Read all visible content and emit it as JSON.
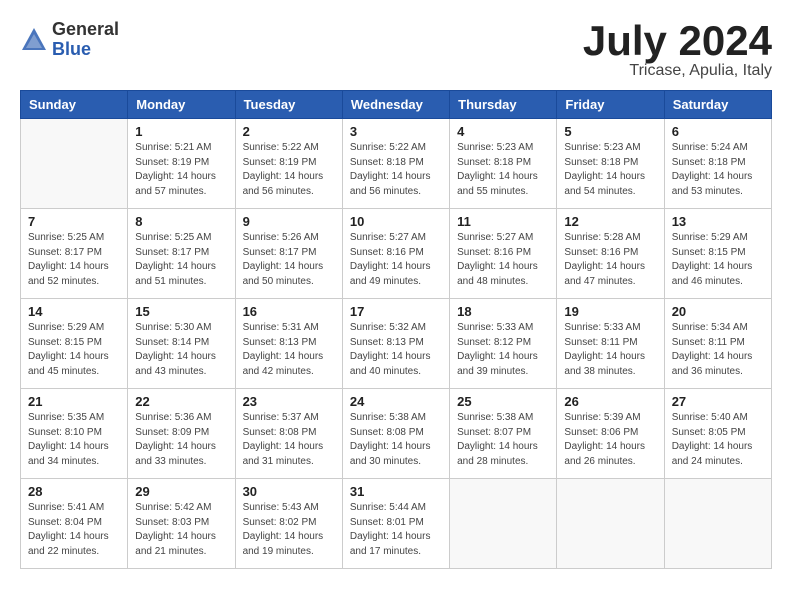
{
  "logo": {
    "general": "General",
    "blue": "Blue"
  },
  "title": {
    "month_year": "July 2024",
    "location": "Tricase, Apulia, Italy"
  },
  "days_of_week": [
    "Sunday",
    "Monday",
    "Tuesday",
    "Wednesday",
    "Thursday",
    "Friday",
    "Saturday"
  ],
  "weeks": [
    [
      {
        "day": "",
        "info": ""
      },
      {
        "day": "1",
        "info": "Sunrise: 5:21 AM\nSunset: 8:19 PM\nDaylight: 14 hours\nand 57 minutes."
      },
      {
        "day": "2",
        "info": "Sunrise: 5:22 AM\nSunset: 8:19 PM\nDaylight: 14 hours\nand 56 minutes."
      },
      {
        "day": "3",
        "info": "Sunrise: 5:22 AM\nSunset: 8:18 PM\nDaylight: 14 hours\nand 56 minutes."
      },
      {
        "day": "4",
        "info": "Sunrise: 5:23 AM\nSunset: 8:18 PM\nDaylight: 14 hours\nand 55 minutes."
      },
      {
        "day": "5",
        "info": "Sunrise: 5:23 AM\nSunset: 8:18 PM\nDaylight: 14 hours\nand 54 minutes."
      },
      {
        "day": "6",
        "info": "Sunrise: 5:24 AM\nSunset: 8:18 PM\nDaylight: 14 hours\nand 53 minutes."
      }
    ],
    [
      {
        "day": "7",
        "info": "Sunrise: 5:25 AM\nSunset: 8:17 PM\nDaylight: 14 hours\nand 52 minutes."
      },
      {
        "day": "8",
        "info": "Sunrise: 5:25 AM\nSunset: 8:17 PM\nDaylight: 14 hours\nand 51 minutes."
      },
      {
        "day": "9",
        "info": "Sunrise: 5:26 AM\nSunset: 8:17 PM\nDaylight: 14 hours\nand 50 minutes."
      },
      {
        "day": "10",
        "info": "Sunrise: 5:27 AM\nSunset: 8:16 PM\nDaylight: 14 hours\nand 49 minutes."
      },
      {
        "day": "11",
        "info": "Sunrise: 5:27 AM\nSunset: 8:16 PM\nDaylight: 14 hours\nand 48 minutes."
      },
      {
        "day": "12",
        "info": "Sunrise: 5:28 AM\nSunset: 8:16 PM\nDaylight: 14 hours\nand 47 minutes."
      },
      {
        "day": "13",
        "info": "Sunrise: 5:29 AM\nSunset: 8:15 PM\nDaylight: 14 hours\nand 46 minutes."
      }
    ],
    [
      {
        "day": "14",
        "info": "Sunrise: 5:29 AM\nSunset: 8:15 PM\nDaylight: 14 hours\nand 45 minutes."
      },
      {
        "day": "15",
        "info": "Sunrise: 5:30 AM\nSunset: 8:14 PM\nDaylight: 14 hours\nand 43 minutes."
      },
      {
        "day": "16",
        "info": "Sunrise: 5:31 AM\nSunset: 8:13 PM\nDaylight: 14 hours\nand 42 minutes."
      },
      {
        "day": "17",
        "info": "Sunrise: 5:32 AM\nSunset: 8:13 PM\nDaylight: 14 hours\nand 40 minutes."
      },
      {
        "day": "18",
        "info": "Sunrise: 5:33 AM\nSunset: 8:12 PM\nDaylight: 14 hours\nand 39 minutes."
      },
      {
        "day": "19",
        "info": "Sunrise: 5:33 AM\nSunset: 8:11 PM\nDaylight: 14 hours\nand 38 minutes."
      },
      {
        "day": "20",
        "info": "Sunrise: 5:34 AM\nSunset: 8:11 PM\nDaylight: 14 hours\nand 36 minutes."
      }
    ],
    [
      {
        "day": "21",
        "info": "Sunrise: 5:35 AM\nSunset: 8:10 PM\nDaylight: 14 hours\nand 34 minutes."
      },
      {
        "day": "22",
        "info": "Sunrise: 5:36 AM\nSunset: 8:09 PM\nDaylight: 14 hours\nand 33 minutes."
      },
      {
        "day": "23",
        "info": "Sunrise: 5:37 AM\nSunset: 8:08 PM\nDaylight: 14 hours\nand 31 minutes."
      },
      {
        "day": "24",
        "info": "Sunrise: 5:38 AM\nSunset: 8:08 PM\nDaylight: 14 hours\nand 30 minutes."
      },
      {
        "day": "25",
        "info": "Sunrise: 5:38 AM\nSunset: 8:07 PM\nDaylight: 14 hours\nand 28 minutes."
      },
      {
        "day": "26",
        "info": "Sunrise: 5:39 AM\nSunset: 8:06 PM\nDaylight: 14 hours\nand 26 minutes."
      },
      {
        "day": "27",
        "info": "Sunrise: 5:40 AM\nSunset: 8:05 PM\nDaylight: 14 hours\nand 24 minutes."
      }
    ],
    [
      {
        "day": "28",
        "info": "Sunrise: 5:41 AM\nSunset: 8:04 PM\nDaylight: 14 hours\nand 22 minutes."
      },
      {
        "day": "29",
        "info": "Sunrise: 5:42 AM\nSunset: 8:03 PM\nDaylight: 14 hours\nand 21 minutes."
      },
      {
        "day": "30",
        "info": "Sunrise: 5:43 AM\nSunset: 8:02 PM\nDaylight: 14 hours\nand 19 minutes."
      },
      {
        "day": "31",
        "info": "Sunrise: 5:44 AM\nSunset: 8:01 PM\nDaylight: 14 hours\nand 17 minutes."
      },
      {
        "day": "",
        "info": ""
      },
      {
        "day": "",
        "info": ""
      },
      {
        "day": "",
        "info": ""
      }
    ]
  ]
}
